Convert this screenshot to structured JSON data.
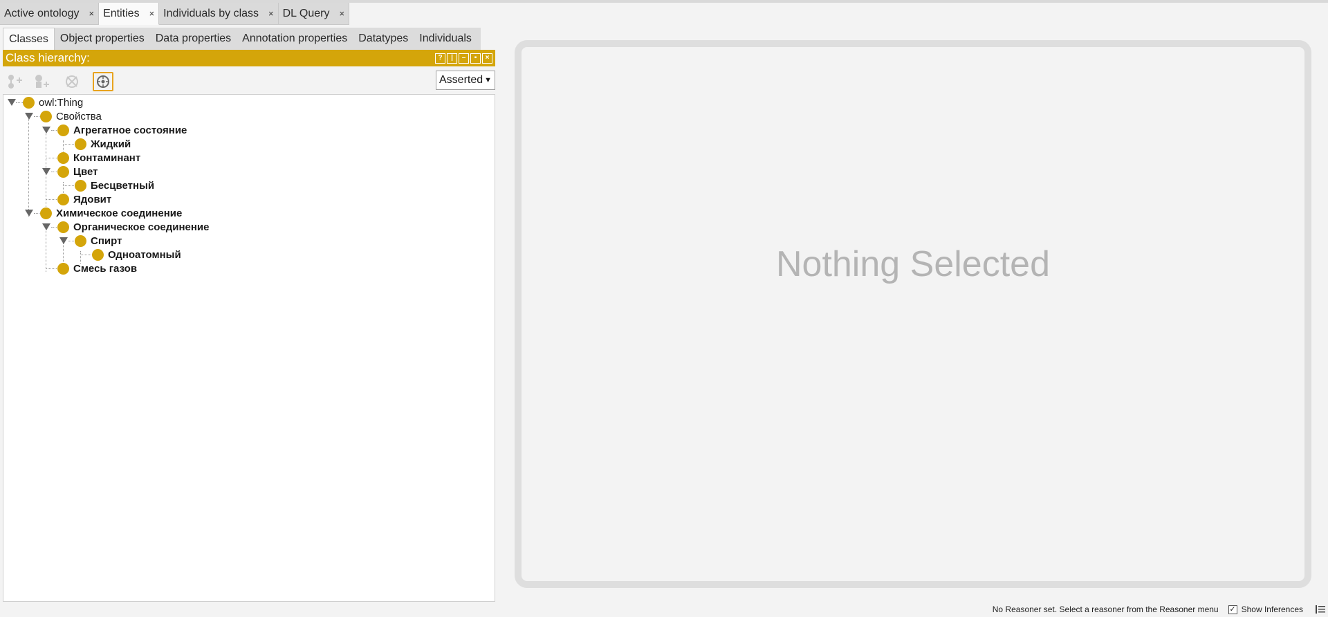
{
  "workspace_tabs": [
    {
      "label": "Active ontology",
      "close": "×"
    },
    {
      "label": "Entities",
      "close": "×"
    },
    {
      "label": "Individuals by class",
      "close": "×"
    },
    {
      "label": "DL Query",
      "close": "×"
    }
  ],
  "entity_tabs": [
    "Classes",
    "Object properties",
    "Data properties",
    "Annotation properties",
    "Datatypes",
    "Individuals"
  ],
  "class_hierarchy": {
    "title": "Class hierarchy:",
    "mode": "Asserted",
    "tree": [
      {
        "label": "owl:Thing",
        "bold": false
      },
      {
        "label": "Свойства",
        "bold": false
      },
      {
        "label": "Агрегатное состояние",
        "bold": true
      },
      {
        "label": "Жидкий",
        "bold": true
      },
      {
        "label": "Контаминант",
        "bold": true
      },
      {
        "label": "Цвет",
        "bold": true
      },
      {
        "label": "Бесцветный",
        "bold": true
      },
      {
        "label": "Ядовит",
        "bold": true
      },
      {
        "label": "Химическое соединение",
        "bold": true
      },
      {
        "label": "Органическое соединение",
        "bold": true
      },
      {
        "label": "Спирт",
        "bold": true
      },
      {
        "label": "Одноатомный",
        "bold": true
      },
      {
        "label": "Смесь газов",
        "bold": true
      }
    ]
  },
  "detail_panel": {
    "empty_text": "Nothing Selected"
  },
  "status_bar": {
    "message": "No Reasoner set. Select a reasoner from the Reasoner menu",
    "show_inferences_label": "Show Inferences",
    "show_inferences_checked": true
  },
  "colors": {
    "accent": "#d4a50a",
    "header_text": "#ffffff",
    "empty_text": "#b4b4b4"
  }
}
